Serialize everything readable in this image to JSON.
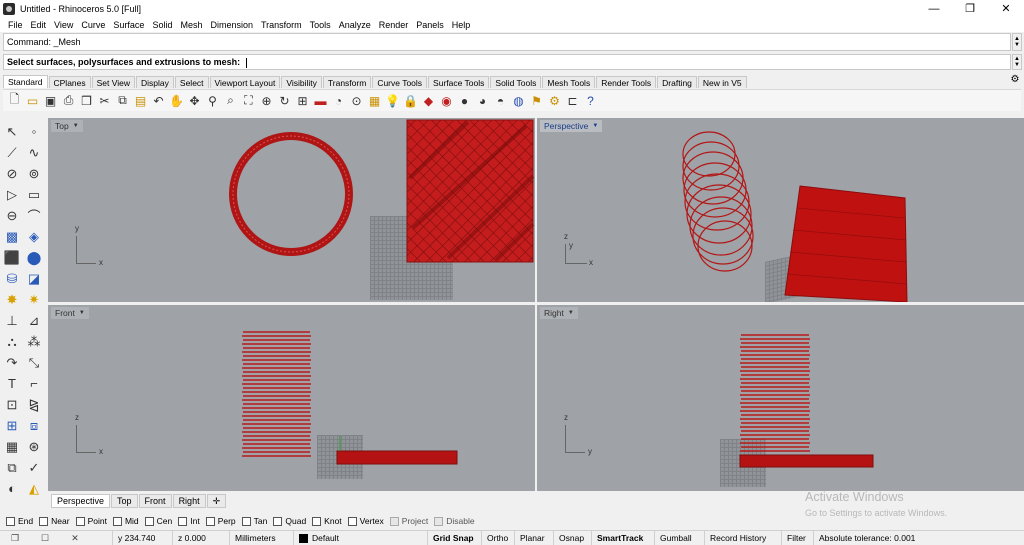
{
  "window": {
    "title": "Untitled - Rhinoceros 5.0 [Full]",
    "controls": {
      "minimize": "—",
      "maximize": "❐",
      "close": "✕"
    }
  },
  "menu": [
    "File",
    "Edit",
    "View",
    "Curve",
    "Surface",
    "Solid",
    "Mesh",
    "Dimension",
    "Transform",
    "Tools",
    "Analyze",
    "Render",
    "Panels",
    "Help"
  ],
  "command": {
    "history": "Command: _Mesh",
    "prompt": "Select surfaces, polysurfaces and extrusions to mesh:"
  },
  "toolbar_tabs": [
    "Standard",
    "CPlanes",
    "Set View",
    "Display",
    "Select",
    "Viewport Layout",
    "Visibility",
    "Transform",
    "Curve Tools",
    "Surface Tools",
    "Solid Tools",
    "Mesh Tools",
    "Render Tools",
    "Drafting",
    "New in V5"
  ],
  "toolbar_icons": [
    "new-file",
    "open-folder",
    "save",
    "print",
    "import",
    "cut",
    "copy",
    "paste",
    "undo",
    "pan",
    "rotate-view",
    "zoom",
    "zoom-window",
    "zoom-extents",
    "zoom-selected",
    "rotate",
    "four-viewports",
    "hide-object",
    "show",
    "lock-object",
    "layer",
    "light-bulb",
    "lock",
    "color",
    "material",
    "shade",
    "rendered",
    "ghosted",
    "render",
    "grid-settings",
    "options",
    "help"
  ],
  "viewports": {
    "top": {
      "label": "Top",
      "axis_v": "y",
      "axis_h": "x"
    },
    "perspective": {
      "label": "Perspective",
      "axis_v": "z",
      "axis_h": "y",
      "axis_d": "x"
    },
    "front": {
      "label": "Front",
      "axis_v": "z",
      "axis_h": "x"
    },
    "right": {
      "label": "Right",
      "axis_v": "z",
      "axis_h": "y"
    }
  },
  "viewport_tabs": [
    "Perspective",
    "Top",
    "Front",
    "Right"
  ],
  "viewport_tab_add": "✛",
  "osnaps": [
    {
      "label": "End",
      "checked": false
    },
    {
      "label": "Near",
      "checked": false
    },
    {
      "label": "Point",
      "checked": false
    },
    {
      "label": "Mid",
      "checked": false
    },
    {
      "label": "Cen",
      "checked": false
    },
    {
      "label": "Int",
      "checked": false
    },
    {
      "label": "Perp",
      "checked": false
    },
    {
      "label": "Tan",
      "checked": false
    },
    {
      "label": "Quad",
      "checked": false
    },
    {
      "label": "Knot",
      "checked": false
    },
    {
      "label": "Vertex",
      "checked": false
    },
    {
      "label": "Project",
      "checked": false
    },
    {
      "label": "Disable",
      "checked": false
    }
  ],
  "watermark": {
    "line1": "Activate Windows",
    "line2": "Go to Settings to activate Windows."
  },
  "status": {
    "y": "y 234.740",
    "z": "z 0.000",
    "units": "Millimeters",
    "layer": "Default",
    "grid_snap": "Grid Snap",
    "ortho": "Ortho",
    "planar": "Planar",
    "osnap": "Osnap",
    "smarttrack": "SmartTrack",
    "gumball": "Gumball",
    "record_history": "Record History",
    "filter": "Filter",
    "tolerance": "Absolute tolerance: 0.001"
  },
  "colors": {
    "mesh": "#c01818",
    "viewport_bg": "#9fa3a7",
    "active_label": "#1a3c8a"
  }
}
